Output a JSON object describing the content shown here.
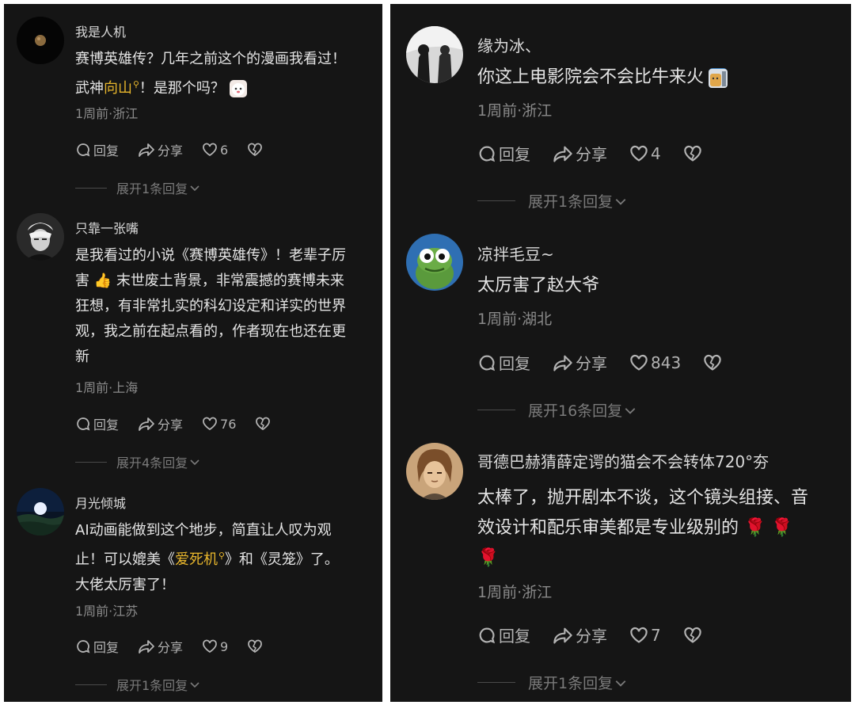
{
  "left_panel": {
    "comments": [
      {
        "username": "我是人机",
        "lines": [
          "赛博英雄传？几年之前这个的漫画我看过！"
        ],
        "line2_prefix": "武神",
        "line2_link": "向山",
        "line2_suffix": "！是那个吗？",
        "emoji": "cat-emoji",
        "meta": "1周前·浙江",
        "reply_label": "回复",
        "share_label": "分享",
        "likes": "6",
        "expand_label": "展开1条回复"
      },
      {
        "username": "只靠一张嘴",
        "lines": [
          "是我看过的小说《赛博英雄传》！老辈子厉",
          "害 👍 末世废土背景，非常震撼的赛博未来",
          "狂想，有非常扎实的科幻设定和详实的世界",
          "观，我之前在起点看的，作者现在也还在更",
          "新"
        ],
        "meta": "1周前·上海",
        "reply_label": "回复",
        "share_label": "分享",
        "likes": "76",
        "expand_label": "展开4条回复"
      },
      {
        "username": "月光倾城",
        "lines": [
          "AI动画能做到这个地步，简直让人叹为观"
        ],
        "line2_prefix": "止！可以媲美《",
        "line2_link": "爱死机",
        "line2_suffix": "》和《灵笼》了。",
        "line3": "大佬太厉害了！",
        "meta": "1周前·江苏",
        "reply_label": "回复",
        "share_label": "分享",
        "likes": "9",
        "expand_label": "展开1条回复"
      }
    ]
  },
  "right_panel": {
    "comments": [
      {
        "username": "缘为冰、",
        "lines": [
          "你这上电影院会不会比牛来火"
        ],
        "emoji": "dog-emoji",
        "meta": "1周前·浙江",
        "reply_label": "回复",
        "share_label": "分享",
        "likes": "4",
        "expand_label": "展开1条回复"
      },
      {
        "username": "凉拌毛豆~",
        "lines": [
          "太厉害了赵大爷"
        ],
        "meta": "1周前·湖北",
        "reply_label": "回复",
        "share_label": "分享",
        "likes": "843",
        "expand_label": "展开16条回复"
      },
      {
        "username": "哥德巴赫猜薛定谔的猫会不会转体720°夯",
        "lines": [
          "太棒了，抛开剧本不谈，这个镜头组接、音",
          "效设计和配乐审美都是专业级别的 🌹  🌹",
          "🌹"
        ],
        "meta": "1周前·浙江",
        "reply_label": "回复",
        "share_label": "分享",
        "likes": "7",
        "expand_label": "展开1条回复"
      }
    ]
  },
  "colors": {
    "background": "#151515",
    "link": "#e8b62c",
    "text": "#e4e4e4",
    "meta": "#8a8a8a"
  }
}
